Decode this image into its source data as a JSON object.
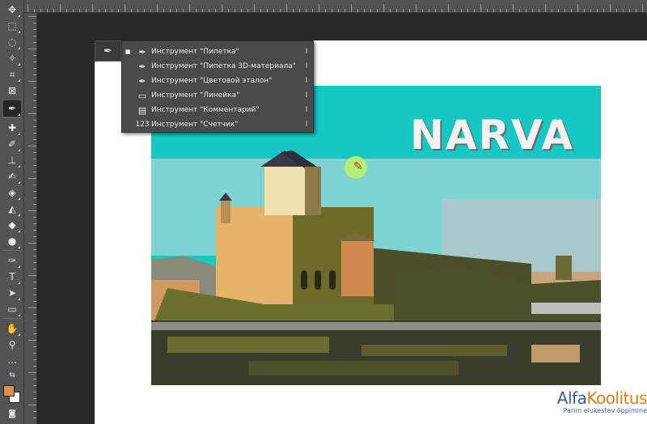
{
  "flyout": {
    "items": [
      {
        "label": "Инструмент \"Пипетка\"",
        "key": "I",
        "selected": true,
        "icon": "eyedropper-icon"
      },
      {
        "label": "Инструмент \"Пипетка 3D-материала\"",
        "key": "I",
        "selected": false,
        "icon": "3d-eyedropper-icon"
      },
      {
        "label": "Инструмент \"Цветовой эталон\"",
        "key": "I",
        "selected": false,
        "icon": "color-sampler-icon"
      },
      {
        "label": "Инструмент \"Линейка\"",
        "key": "I",
        "selected": false,
        "icon": "ruler-icon"
      },
      {
        "label": "Инструмент \"Комментарий\"",
        "key": "I",
        "selected": false,
        "icon": "note-icon"
      },
      {
        "label": "Инструмент \"Счетчик\"",
        "key": "I",
        "selected": false,
        "icon": "count-icon"
      }
    ],
    "count_icon_text": "123"
  },
  "image": {
    "title_text": "NARVA"
  },
  "colors": {
    "foreground": "#d9924e",
    "background": "#ffffff"
  },
  "logo": {
    "part1": "Alfa",
    "part2": "Koolitus",
    "tagline": "Parim elukestev õppimine"
  }
}
